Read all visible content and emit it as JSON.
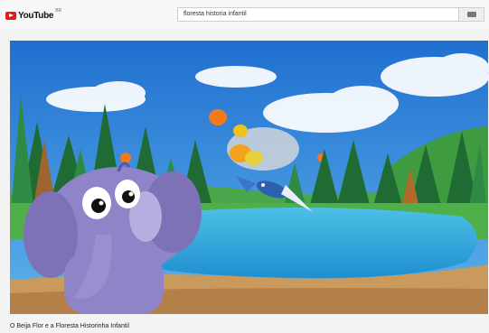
{
  "app": {
    "logo_text": "YouTube",
    "logo_superscript": "BR"
  },
  "search": {
    "value": "floresta historia infantil",
    "icon": "search-icon"
  },
  "video": {
    "title": "O Beija Flor e a Floresta Historinha Infantil"
  },
  "colors": {
    "brand_red": "#e21b1b",
    "sky": "#2a86d8",
    "lake": "#2fa7d6",
    "elephant": "#9a8fd0",
    "bird": "#2f5fb0"
  }
}
